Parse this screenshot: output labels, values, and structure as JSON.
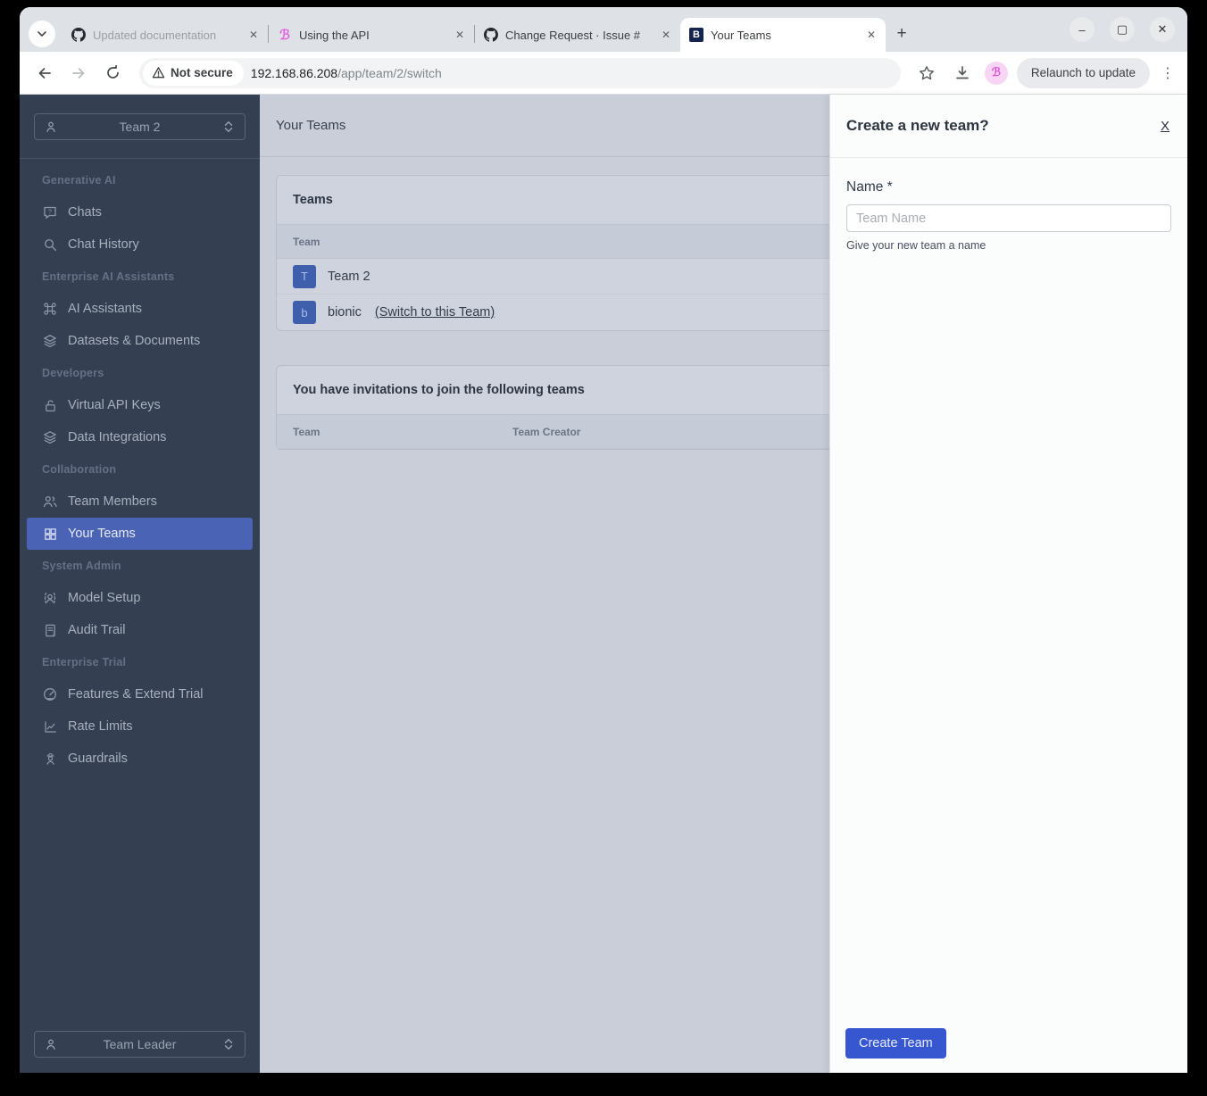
{
  "browser": {
    "tabs": [
      {
        "title": "Updated documentation",
        "icon": "github-icon",
        "close_glyph": "✕"
      },
      {
        "title": "Using the API",
        "icon": "bionic-b-pink-icon",
        "close_glyph": "✕"
      },
      {
        "title": "Change Request · Issue #",
        "icon": "github-icon",
        "close_glyph": "✕"
      },
      {
        "title": "Your Teams",
        "icon": "bionic-b-navy-icon",
        "close_glyph": "✕"
      }
    ],
    "new_tab_glyph": "+",
    "window_controls": {
      "minimize": "–",
      "maximize": "▢",
      "close": "✕"
    },
    "address": {
      "security_label": "Not secure",
      "host": "192.168.86.208",
      "path": "/app/team/2/switch"
    },
    "favicon_b": "B",
    "favicon_b_fancy": "ℬ",
    "relaunch_label": "Relaunch to update",
    "menu_glyph": "⋮"
  },
  "sidebar": {
    "team_selector": "Team 2",
    "role_selector": "Team Leader",
    "sections": [
      {
        "label": "Generative AI",
        "items": [
          {
            "label": "Chats"
          },
          {
            "label": "Chat History"
          }
        ]
      },
      {
        "label": "Enterprise AI Assistants",
        "items": [
          {
            "label": "AI Assistants"
          },
          {
            "label": "Datasets & Documents"
          }
        ]
      },
      {
        "label": "Developers",
        "items": [
          {
            "label": "Virtual API Keys"
          },
          {
            "label": "Data Integrations"
          }
        ]
      },
      {
        "label": "Collaboration",
        "items": [
          {
            "label": "Team Members"
          },
          {
            "label": "Your Teams"
          }
        ]
      },
      {
        "label": "System Admin",
        "items": [
          {
            "label": "Model Setup"
          },
          {
            "label": "Audit Trail"
          }
        ]
      },
      {
        "label": "Enterprise Trial",
        "items": [
          {
            "label": "Features & Extend Trial"
          },
          {
            "label": "Rate Limits"
          },
          {
            "label": "Guardrails"
          }
        ]
      }
    ]
  },
  "main": {
    "page_title": "Your Teams",
    "teams_card": {
      "title": "Teams",
      "columns": [
        "Team"
      ],
      "rows": [
        {
          "avatar": "T",
          "name": "Team 2",
          "link": ""
        },
        {
          "avatar": "b",
          "name": "bionic",
          "link": "(Switch to this Team)"
        }
      ]
    },
    "invitations_card": {
      "title": "You have invitations to join the following teams",
      "columns": [
        "Team",
        "Team Creator"
      ]
    }
  },
  "drawer": {
    "title": "Create a new team?",
    "close_label": "X",
    "name_label": "Name *",
    "name_placeholder": "Team Name",
    "name_help": "Give your new team a name",
    "submit_label": "Create Team"
  },
  "colors": {
    "sidebar_bg": "#343f51",
    "sidebar_active": "#4a63b4",
    "primary_button": "#3757d0",
    "avatar_blue": "#3f5fad",
    "brand_pink": "#e55fe0",
    "brand_navy": "#16254f",
    "main_dimmed_bg": "#c9ced8"
  }
}
